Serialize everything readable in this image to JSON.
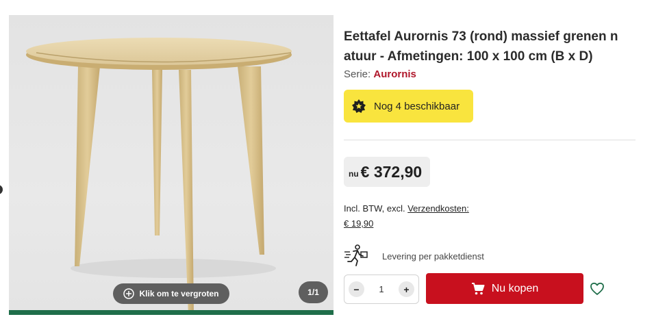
{
  "gallery": {
    "zoom_label": "Klik om te vergroten",
    "counter": "1/1",
    "zoom_icon": "plus-circle-icon"
  },
  "product": {
    "title": "Eettafel Aurornis 73 (rond) massief grenen n atuur - Afmetingen: 100 x 100 cm (B x D)",
    "series_label": "Serie:",
    "series_name": "Aurornis"
  },
  "stock": {
    "text": "Nog 4 beschikbaar",
    "icon": "badge-star-icon",
    "background": "#f9e43e"
  },
  "price": {
    "prefix": "nu",
    "value": "€ 372,90",
    "vat_text": "Incl. BTW, excl.",
    "shipping_link": "Verzendkosten:",
    "shipping_cost": "€ 19,90"
  },
  "delivery": {
    "text": "Levering per pakketdienst",
    "icon": "courier-icon"
  },
  "purchase": {
    "quantity": "1",
    "minus": "−",
    "plus": "+",
    "buy_label": "Nu kopen",
    "buy_icon": "cart-icon",
    "wishlist_icon": "heart-icon",
    "buy_color": "#c8101e"
  }
}
